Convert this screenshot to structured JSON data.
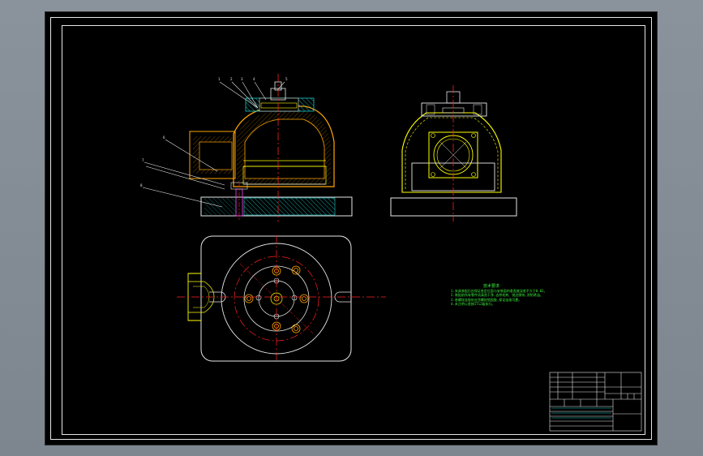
{
  "app": {
    "name": "CAD drawing viewer"
  },
  "colors": {
    "background": "#000000",
    "frame": "#e6e6e6",
    "outline": "#ffff00",
    "section": "#ffa500",
    "center": "#ff2020",
    "notes": "#3cf03c",
    "leader": "#ffffff"
  },
  "drawing": {
    "leader_labels": [
      "1",
      "2",
      "3",
      "4",
      "5",
      "6",
      "7",
      "8",
      "9"
    ],
    "views": [
      "front-section-view",
      "side-view",
      "top-view"
    ]
  },
  "technical_notes": {
    "title": "技术要求",
    "lines": [
      "1.夹具装配后应保证各定位面与安装面的垂直度误差不大于0.02。",
      "2.装配前所有零件须清洗干净,去除毛刺、锐边倒钝,涂防锈油。",
      "3.各螺纹连接处应涂螺纹锁固胶,保证连接可靠。",
      "4.未注明公差按IT12级执行。"
    ]
  },
  "title_block": {
    "rows": [
      "",
      "",
      "",
      "",
      "",
      ""
    ]
  }
}
